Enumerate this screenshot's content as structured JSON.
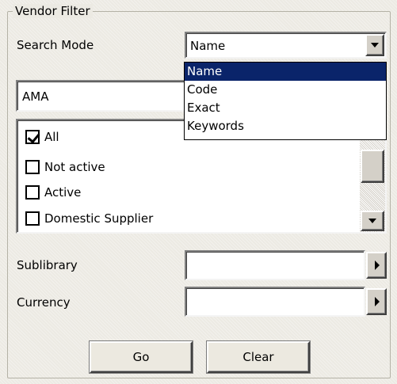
{
  "panel": {
    "title": "Vendor Filter"
  },
  "search_mode": {
    "label": "Search Mode",
    "selected": "Name",
    "options": [
      "Name",
      "Code",
      "Exact",
      "Keywords"
    ]
  },
  "search_text": {
    "value": "AMA"
  },
  "status_list": {
    "items": [
      {
        "label": "All",
        "checked": true
      },
      {
        "label": "Not active",
        "checked": false
      },
      {
        "label": "Active",
        "checked": false
      },
      {
        "label": "Domestic Supplier",
        "checked": false
      }
    ]
  },
  "sublibrary": {
    "label": "Sublibrary",
    "value": ""
  },
  "currency": {
    "label": "Currency",
    "value": ""
  },
  "buttons": {
    "go": "Go",
    "clear": "Clear"
  },
  "icons": {
    "dropdown": "chevron-down-icon",
    "picker": "triangle-right-icon",
    "checkbox": "checkmark-icon"
  }
}
